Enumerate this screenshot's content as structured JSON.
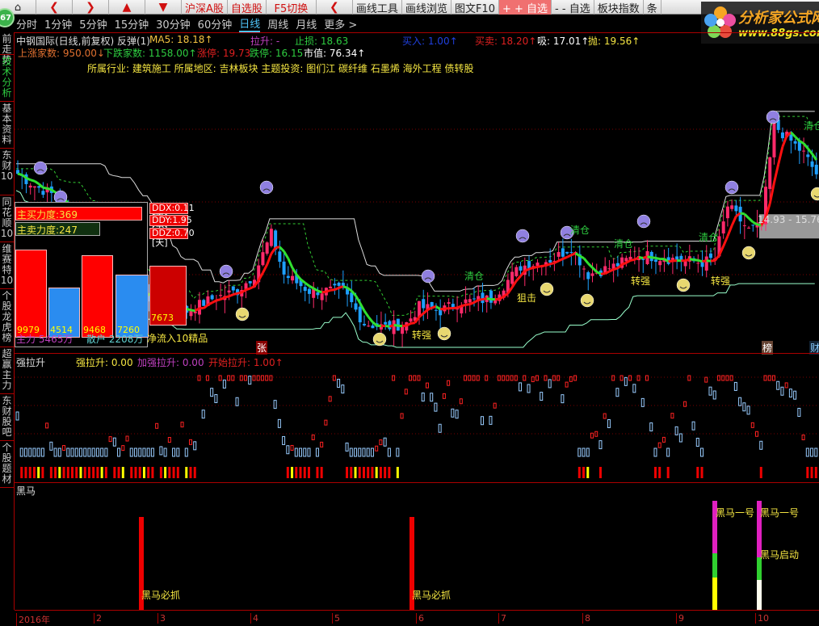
{
  "toolbar": {
    "buttons": [
      "沪深A股",
      "自选股",
      "F5切换",
      "画线工具",
      "画线浏览",
      "图文F10",
      "+ + 自选",
      "- - 自选",
      "板块指数",
      "条"
    ]
  },
  "badge": "67",
  "periods": [
    "分时",
    "1分钟",
    "5分钟",
    "15分钟",
    "30分钟",
    "60分钟",
    "日线",
    "周线",
    "月线",
    "更多 >"
  ],
  "active_period": "日线",
  "logo": {
    "name": "分析家公式网",
    "url": "www.88gs.com"
  },
  "sidebar": [
    "前走势",
    "技术分析",
    "基本资料",
    "东财10",
    "同花顺10",
    "维赛特10",
    "个股龙虎榜",
    "超赢主力",
    "东财股吧",
    "个股题材"
  ],
  "info": {
    "title": "中钢国际(日线,前复权) 反弹(1)",
    "ma5": "MA5: 18.18↑",
    "lasheng": "拉升: -",
    "zhisun": "止损: 18.63",
    "mairu": "买入: 1.00↑",
    "maimai": "买卖: 18.20↑",
    "xi": "吸: 17.01↑",
    "pao": "抛: 19.56↑",
    "up_count": "上涨家数: 950.00↓",
    "down_count": "下跌家数: 1158.00↑",
    "zhangting": "涨停: 19.73",
    "dieting": "跌停: 16.15",
    "shizhi": "市值: 76.34↑",
    "sector": "所属行业: 建筑施工 所属地区: 吉林板块 主题投资: 图们江 碳纤维 石墨烯 海外工程 债转股"
  },
  "ddx": {
    "buy": "主买力度:369",
    "sell": "主卖力度:247",
    "bars": [
      {
        "v": "9979",
        "c": "#ff0000",
        "h": 0.65
      },
      {
        "v": "4514",
        "c": "#2a8cf0",
        "h": 0.37
      },
      {
        "v": "9468",
        "c": "#ff0000",
        "h": 0.61
      },
      {
        "v": "7260",
        "c": "#2a8cf0",
        "h": 0.47
      },
      {
        "v": "7673",
        "c": "#cc0000",
        "h": 0.5
      }
    ],
    "zhuli": "主力 5465万",
    "sanhu": "散户 2208万",
    "jingliuru": "净流入10精品",
    "ddx": "DDX:0.11 [天]",
    "ddy": "DDY:1.95 [天]",
    "ddz": "DDZ:0.70 [天]"
  },
  "chart_labels": {
    "qingcang": "清仓",
    "jueji": "狙击",
    "zhuanqiang": "转强",
    "zhang": "张",
    "bang": "榜",
    "cai": "财",
    "range": "14.93 - 15.76"
  },
  "panel2": {
    "title": "强拉升",
    "qls": "强拉升: 0.00",
    "jqls": "加强拉升: 0.00",
    "ksls": "开始拉升: 1.00↑"
  },
  "panel3": {
    "title": "黑马",
    "bizhua": "黑马必抓",
    "yihao": "黑马一号",
    "qidong": "黑马启动"
  },
  "axis": [
    "2016年",
    "2",
    "3",
    "4",
    "5",
    "6",
    "7",
    "8",
    "9",
    "10"
  ],
  "colors": {
    "up": "#ff2a6a",
    "down": "#1ea0ff",
    "ma_up": "#ff1010",
    "ma_down": "#30e030",
    "grid": "#a00000"
  },
  "chart_data": {
    "type": "candlestick",
    "bars": 190,
    "key_closes": [
      [
        0,
        17.46
      ],
      [
        4,
        17.1
      ],
      [
        8,
        16.85
      ],
      [
        12,
        16.25
      ],
      [
        19,
        14.68
      ],
      [
        31,
        13.71
      ],
      [
        40,
        13.35
      ],
      [
        46,
        13.71
      ],
      [
        52,
        13.95
      ],
      [
        56,
        14.44
      ],
      [
        60,
        15.65
      ],
      [
        63,
        14.44
      ],
      [
        69,
        13.95
      ],
      [
        77,
        13.95
      ],
      [
        82,
        12.98
      ],
      [
        87,
        12.86
      ],
      [
        92,
        12.98
      ],
      [
        95,
        13.47
      ],
      [
        100,
        13.35
      ],
      [
        104,
        13.59
      ],
      [
        112,
        13.71
      ],
      [
        119,
        14.68
      ],
      [
        127,
        14.92
      ],
      [
        131,
        15.28
      ],
      [
        135,
        14.44
      ],
      [
        141,
        14.68
      ],
      [
        147,
        15.04
      ],
      [
        154,
        14.92
      ],
      [
        162,
        14.8
      ],
      [
        165,
        14.92
      ],
      [
        168,
        16.49
      ],
      [
        173,
        15.77
      ],
      [
        176,
        15.89
      ],
      [
        179,
        18.91
      ],
      [
        183,
        18.43
      ],
      [
        186,
        18.06
      ],
      [
        189,
        17.46
      ]
    ],
    "price_range": [
      12.5,
      20
    ],
    "range_box": [
      14.93,
      15.76
    ]
  }
}
